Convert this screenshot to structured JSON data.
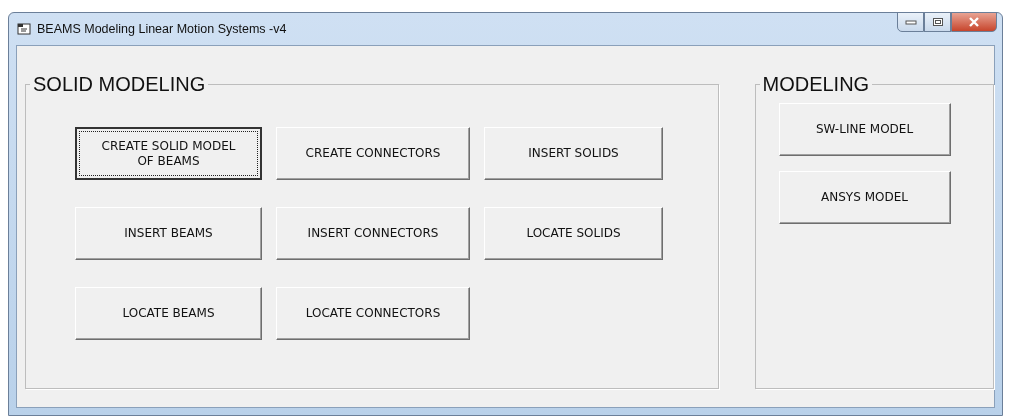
{
  "window": {
    "title": "BEAMS Modeling Linear Motion Systems -v4"
  },
  "groups": [
    {
      "title": "SOLID MODELING",
      "buttons": [
        {
          "label": "CREATE SOLID MODEL OF BEAMS",
          "focused": true
        },
        {
          "label": "CREATE CONNECTORS",
          "focused": false
        },
        {
          "label": "INSERT SOLIDS",
          "focused": false
        },
        {
          "label": "INSERT BEAMS",
          "focused": false
        },
        {
          "label": "INSERT CONNECTORS",
          "focused": false
        },
        {
          "label": "LOCATE SOLIDS",
          "focused": false
        },
        {
          "label": "LOCATE BEAMS",
          "focused": false
        },
        {
          "label": "LOCATE CONNECTORS",
          "focused": false
        }
      ]
    },
    {
      "title": "MODELING",
      "buttons": [
        {
          "label": "SW-LINE MODEL",
          "focused": false
        },
        {
          "label": "ANSYS MODEL",
          "focused": false
        }
      ]
    }
  ]
}
